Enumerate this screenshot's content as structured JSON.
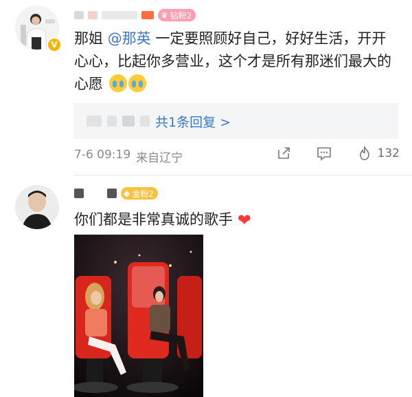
{
  "comment1": {
    "badge": "钻粉2",
    "content_pre": "那姐 ",
    "mention": "@那英",
    "content_post": " 一定要照顾好自己，好好生活，开开心心，比起你多营业，这个才是所有那迷们最大的心愿",
    "emoji_name": "crying-face-emoji",
    "reply_link": "共1条回复 >",
    "time": "7-6 09:19",
    "source": "来自辽宁",
    "like_count": "132"
  },
  "comment2": {
    "badge": "金粉2",
    "content": "你们都是非常真诚的歌手",
    "emoji_name": "red-heart-emoji",
    "heart_glyph": "❤"
  },
  "icons": {
    "share": "share-icon",
    "comment": "comment-icon",
    "like": "like-icon"
  },
  "colors": {
    "link": "#3d76c4",
    "diamond_badge": "#ff9eb0",
    "gold_badge": "#f7c23f"
  }
}
